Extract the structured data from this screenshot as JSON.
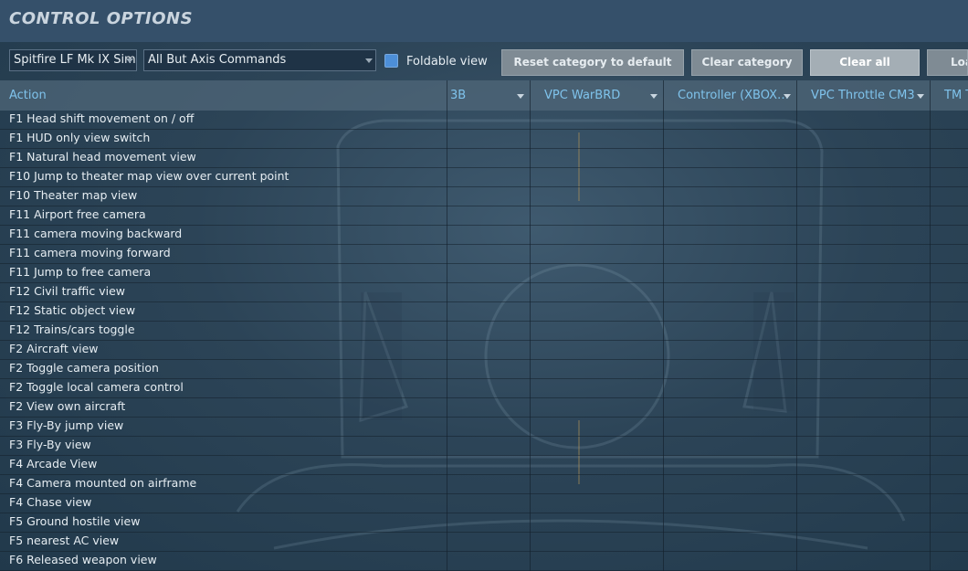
{
  "title": "CONTROL OPTIONS",
  "toolbar": {
    "aircraft_select": "Spitfire LF Mk IX Sim",
    "category_select": "All But Axis Commands",
    "foldable_label": "Foldable view",
    "foldable_checked": true,
    "reset_label": "Reset category to default",
    "clear_category_label": "Clear category",
    "clear_all_label": "Clear all",
    "load_label": "Loa"
  },
  "table": {
    "columns": [
      {
        "label": "Action"
      },
      {
        "label": "3B"
      },
      {
        "label": "VPC WarBRD"
      },
      {
        "label": "Controller (XBOX…"
      },
      {
        "label": "VPC Throttle CM3"
      },
      {
        "label": "TM T"
      }
    ],
    "rows": [
      "F1 Head shift movement on / off",
      "F1 HUD only view switch",
      "F1 Natural head movement view",
      "F10 Jump to theater map view over current point",
      "F10 Theater map view",
      "F11 Airport free camera",
      "F11 camera moving backward",
      "F11 camera moving forward",
      "F11 Jump to free camera",
      "F12 Civil traffic view",
      "F12 Static object view",
      "F12 Trains/cars toggle",
      "F2 Aircraft view",
      "F2 Toggle camera position",
      "F2 Toggle local camera control",
      "F2 View own aircraft",
      "F3 Fly-By jump view",
      "F3 Fly-By view",
      "F4 Arcade View",
      "F4 Camera mounted on airframe",
      "F4 Chase view",
      "F5 Ground hostile view",
      "F5 nearest AC view",
      "F6 Released weapon view"
    ]
  },
  "colors": {
    "header_text": "#7fc3ec",
    "checkbox": "#4d8fd8",
    "button": "#7f8b94"
  }
}
